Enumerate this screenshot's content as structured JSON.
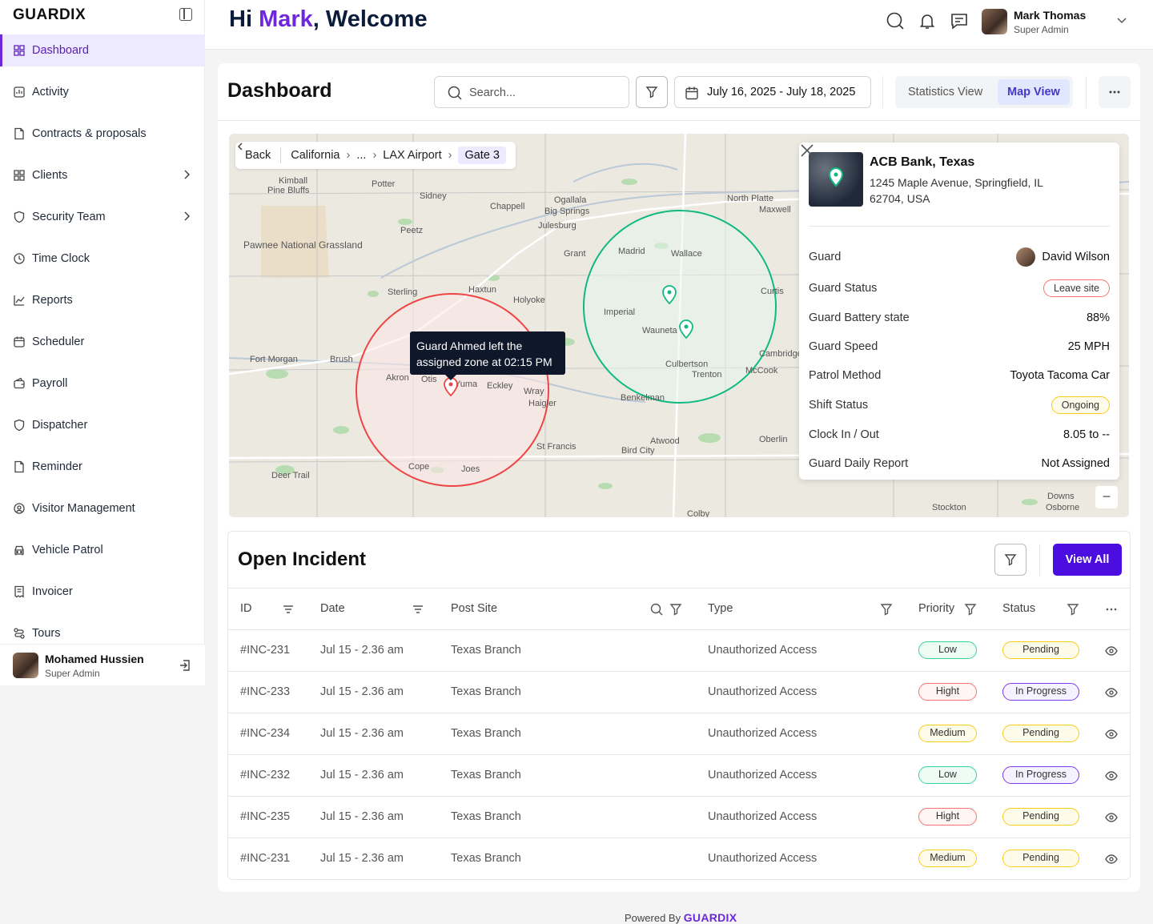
{
  "sidebar": {
    "brand": "GUARDIX",
    "items": [
      {
        "label": "Dashboard",
        "icon": "grid-icon",
        "active": true
      },
      {
        "label": "Activity",
        "icon": "activity-icon"
      },
      {
        "label": "Contracts & proposals",
        "icon": "file-icon"
      },
      {
        "label": "Clients",
        "icon": "grid-icon",
        "chevron": true
      },
      {
        "label": "Security Team",
        "icon": "shield-icon",
        "chevron": true
      },
      {
        "label": "Time Clock",
        "icon": "clock-icon"
      },
      {
        "label": "Reports",
        "icon": "chart-icon"
      },
      {
        "label": "Scheduler",
        "icon": "calendar-icon"
      },
      {
        "label": "Payroll",
        "icon": "wallet-icon"
      },
      {
        "label": "Dispatcher",
        "icon": "shield-icon"
      },
      {
        "label": "Reminder",
        "icon": "file-icon"
      },
      {
        "label": "Visitor Management",
        "icon": "visitor-icon"
      },
      {
        "label": "Vehicle Patrol",
        "icon": "car-icon"
      },
      {
        "label": "Invoicer",
        "icon": "invoice-icon"
      },
      {
        "label": "Tours",
        "icon": "route-icon"
      }
    ],
    "user": {
      "name": "Mohamed Hussien",
      "role": "Super Admin"
    }
  },
  "topbar": {
    "greeting_prefix": "Hi ",
    "greeting_name": "Mark",
    "greeting_suffix": ", Welcome",
    "user": {
      "name": "Mark Thomas",
      "role": "Super Admin"
    }
  },
  "dashboard": {
    "title": "Dashboard",
    "search_placeholder": "Search...",
    "date_range": "July 16, 2025 - July 18, 2025",
    "views": [
      "Statistics View",
      "Map View"
    ],
    "active_view": "Map View"
  },
  "map": {
    "breadcrumb": {
      "back": "Back",
      "items": [
        "California",
        "...",
        "LAX Airport"
      ],
      "current": "Gate 3"
    },
    "tooltip": "Guard Ahmed left the assigned zone at 02:15 PM",
    "places": [
      "Kimball",
      "Pine Bluffs",
      "Potter",
      "Sidney",
      "Chappell",
      "Ogallala",
      "Big Springs",
      "North Platte",
      "Maxwell",
      "Julesburg",
      "Peetz",
      "Pawnee National Grassland",
      "Grant",
      "Madrid",
      "Wallace",
      "Sterling",
      "Haxtun",
      "Holyoke",
      "Imperial",
      "Curtis",
      "Wauneta",
      "Fort Morgan",
      "Brush",
      "Akron",
      "Otis",
      "Yuma",
      "Eckley",
      "Wray",
      "Haigler",
      "Culbertson",
      "Trenton",
      "McCook",
      "Cambridge",
      "Benkelman",
      "St Francis",
      "Atwood",
      "Oberlin",
      "Bird City",
      "Cope",
      "Joes",
      "Deer Trail",
      "Stockton",
      "Downs",
      "Osborne",
      "Colby"
    ],
    "info": {
      "site_name": "ACB Bank, Texas",
      "address": "1245 Maple Avenue, Springfield, IL 62704, USA",
      "rows": [
        {
          "label": "Guard",
          "value": "David Wilson",
          "type": "avatar"
        },
        {
          "label": "Guard Status",
          "value": "Leave site",
          "type": "pill-red"
        },
        {
          "label": "Guard Battery state",
          "value": "88%"
        },
        {
          "label": "Guard Speed",
          "value": "25 MPH"
        },
        {
          "label": "Patrol Method",
          "value": "Toyota Tacoma Car"
        },
        {
          "label": "Shift Status",
          "value": "Ongoing",
          "type": "pill-yellow"
        },
        {
          "label": "Clock In / Out",
          "value": "8.05 to --"
        },
        {
          "label": "Guard Daily Report",
          "value": "Not Assigned"
        }
      ]
    }
  },
  "incidents": {
    "title": "Open Incident",
    "view_all": "View All",
    "columns": [
      "ID",
      "Date",
      "Post Site",
      "Type",
      "Priority",
      "Status"
    ],
    "rows": [
      {
        "id": "#INC-231",
        "date": "Jul 15 - 2.36 am",
        "site": "Texas Branch",
        "type": "Unauthorized Access",
        "priority": "Low",
        "status": "Pending"
      },
      {
        "id": "#INC-233",
        "date": "Jul 15 - 2.36 am",
        "site": "Texas Branch",
        "type": "Unauthorized Access",
        "priority": "Hight",
        "status": "In Progress"
      },
      {
        "id": "#INC-234",
        "date": "Jul 15 - 2.36 am",
        "site": "Texas Branch",
        "type": "Unauthorized Access",
        "priority": "Medium",
        "status": "Pending"
      },
      {
        "id": "#INC-232",
        "date": "Jul 15 - 2.36 am",
        "site": "Texas Branch",
        "type": "Unauthorized Access",
        "priority": "Low",
        "status": "In Progress"
      },
      {
        "id": "#INC-235",
        "date": "Jul 15 - 2.36 am",
        "site": "Texas Branch",
        "type": "Unauthorized Access",
        "priority": "Hight",
        "status": "Pending"
      },
      {
        "id": "#INC-231",
        "date": "Jul 15 - 2.36 am",
        "site": "Texas Branch",
        "type": "Unauthorized Access",
        "priority": "Medium",
        "status": "Pending"
      }
    ]
  },
  "footer": {
    "powered_by": "Powered By",
    "brand": "GUARDIX"
  },
  "colors": {
    "accent": "#6d28d9",
    "primary_button": "#4c0ee0",
    "zone_alert": "#ef4444",
    "zone_ok": "#10b981"
  }
}
